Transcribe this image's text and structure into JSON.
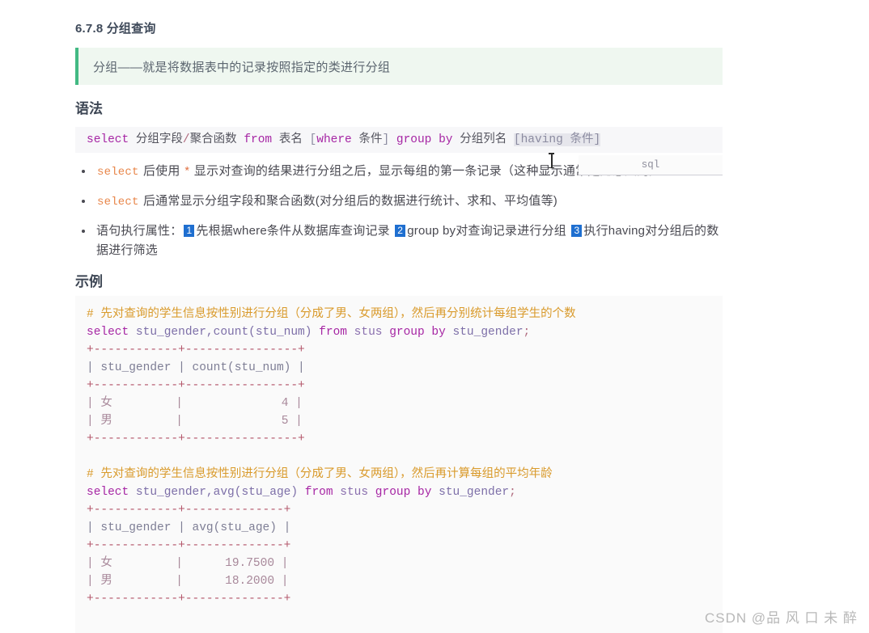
{
  "document": {
    "section_number": "6.7.8",
    "section_title": "分组查询",
    "section_heading": "6.7.8 分组查询",
    "blockquote": "分组——就是将数据表中的记录按照指定的类进行分组",
    "syntax_heading": "语法",
    "example_heading": "示例"
  },
  "syntax_code": {
    "language_label": "sql",
    "tokens": {
      "select": "select",
      "group_field": " 分组字段",
      "slash": "/",
      "agg_func": "聚合函数 ",
      "from": "from",
      "table_name": " 表名 ",
      "where_open": "[",
      "where": "where",
      "where_cond": " 条件",
      "where_close": "]",
      "group": " group",
      "by": " by",
      "group_col": " 分组列名 ",
      "having_clause": "[having 条件]"
    },
    "full_text": "select 分组字段/聚合函数 from 表名 [where 条件] group by 分组列名 [having 条件]"
  },
  "bullets": [
    {
      "code": "select",
      "text_a": " 后使用 ",
      "star": "*",
      "text_b": " 显示对查询的结果进行分组之后，显示每组的第一条记录（这种显示通常是无意义的）"
    },
    {
      "code": "select",
      "text_a": " 后通常显示分组字段和聚合函数(对分组后的数据进行统计、求和、平均值等)"
    },
    {
      "label": "语句执行属性：",
      "steps": [
        {
          "num": "1",
          "text": "先根据where条件从数据库查询记录 "
        },
        {
          "num": "2",
          "text": "group by对查询记录进行分组 "
        },
        {
          "num": "3",
          "text": "执行having对分组后的数据进行筛选"
        }
      ]
    }
  ],
  "examples": [
    {
      "comment": "# 先对查询的学生信息按性别进行分组（分成了男、女两组），然后再分别统计每组学生的个数",
      "query": {
        "select": "select",
        "columns": " stu_gender,count(stu_num) ",
        "from": "from",
        "table": " stus ",
        "group": "group",
        "by": " by",
        "group_col": " stu_gender",
        "semicolon": ";",
        "full": "select stu_gender,count(stu_num) from stus group by stu_gender;"
      },
      "result_table": {
        "border": "+------------+----------------+",
        "header_cells": [
          "stu_gender",
          "count(stu_num)"
        ],
        "header_line": "| stu_gender | count(stu_num) |",
        "rows": [
          {
            "gender": "女",
            "value": "4",
            "line": "| 女         |              4 |"
          },
          {
            "gender": "男",
            "value": "5",
            "line": "| 男         |              5 |"
          }
        ]
      }
    },
    {
      "comment": "# 先对查询的学生信息按性别进行分组（分成了男、女两组），然后再计算每组的平均年龄",
      "query": {
        "select": "select",
        "columns": " stu_gender,avg(stu_age) ",
        "from": "from",
        "table": " stus ",
        "group": "group",
        "by": " by",
        "group_col": " stu_gender",
        "semicolon": ";",
        "full": "select stu_gender,avg(stu_age) from stus group by stu_gender;"
      },
      "result_table": {
        "border": "+------------+--------------+",
        "header_cells": [
          "stu_gender",
          "avg(stu_age)"
        ],
        "header_line": "| stu_gender | avg(stu_age) |",
        "rows": [
          {
            "gender": "女",
            "value": "19.7500",
            "line": "| 女         |      19.7500 |"
          },
          {
            "gender": "男",
            "value": "18.2000",
            "line": "| 男         |      18.2000 |"
          }
        ]
      }
    }
  ],
  "watermark": "CSDN @品 风 口 未 醉",
  "colors": {
    "accent_green": "#42b983",
    "blockquote_bg": "#eff7f0",
    "badge_blue": "#1f6fd0",
    "keyword_purple": "#a626a4",
    "comment_orange": "#d99a2b",
    "table_border_red": "#b4576b",
    "code_bg": "#f8f8f8"
  }
}
